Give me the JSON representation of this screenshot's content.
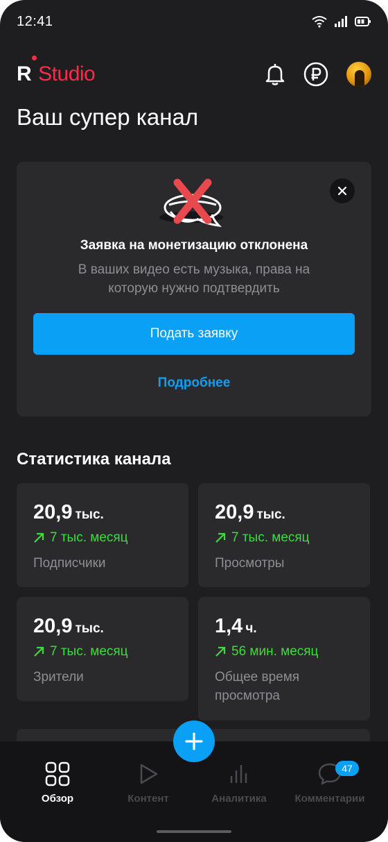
{
  "status_bar": {
    "time": "12:41"
  },
  "header": {
    "logo_letter": "R",
    "logo_word": "Studio",
    "brand_color": "#ff2b48"
  },
  "page": {
    "title": "Ваш супер канал"
  },
  "notice": {
    "title": "Заявка на монетизацию отклонена",
    "text": "В ваших видео есть музыка, права на которую нужно подтвердить",
    "primary_button": "Подать заявку",
    "link": "Подробнее",
    "accent_color": "#0aa0f6"
  },
  "stats": {
    "title": "Статистика канала",
    "cards": [
      {
        "value": "20,9",
        "unit": "тыс.",
        "delta": "7 тыс. месяц",
        "label": "Подписчики"
      },
      {
        "value": "20,9",
        "unit": "тыс.",
        "delta": "7 тыс. месяц",
        "label": "Просмотры"
      },
      {
        "value": "20,9",
        "unit": "тыс.",
        "delta": "7 тыс. месяц",
        "label": "Зрители"
      },
      {
        "value": "1,4",
        "unit": "ч.",
        "delta": "56 мин. месяц",
        "label": "Общее время просмотра"
      }
    ],
    "delta_color": "#3ddc3d"
  },
  "nav": {
    "items": [
      {
        "label": "Обзор",
        "icon": "grid-icon",
        "active": true
      },
      {
        "label": "Контент",
        "icon": "play-icon",
        "active": false
      },
      {
        "label": "Аналитика",
        "icon": "bar-chart-icon",
        "active": false
      },
      {
        "label": "Комментарии",
        "icon": "comment-icon",
        "active": false
      }
    ],
    "comments_badge": "47"
  }
}
